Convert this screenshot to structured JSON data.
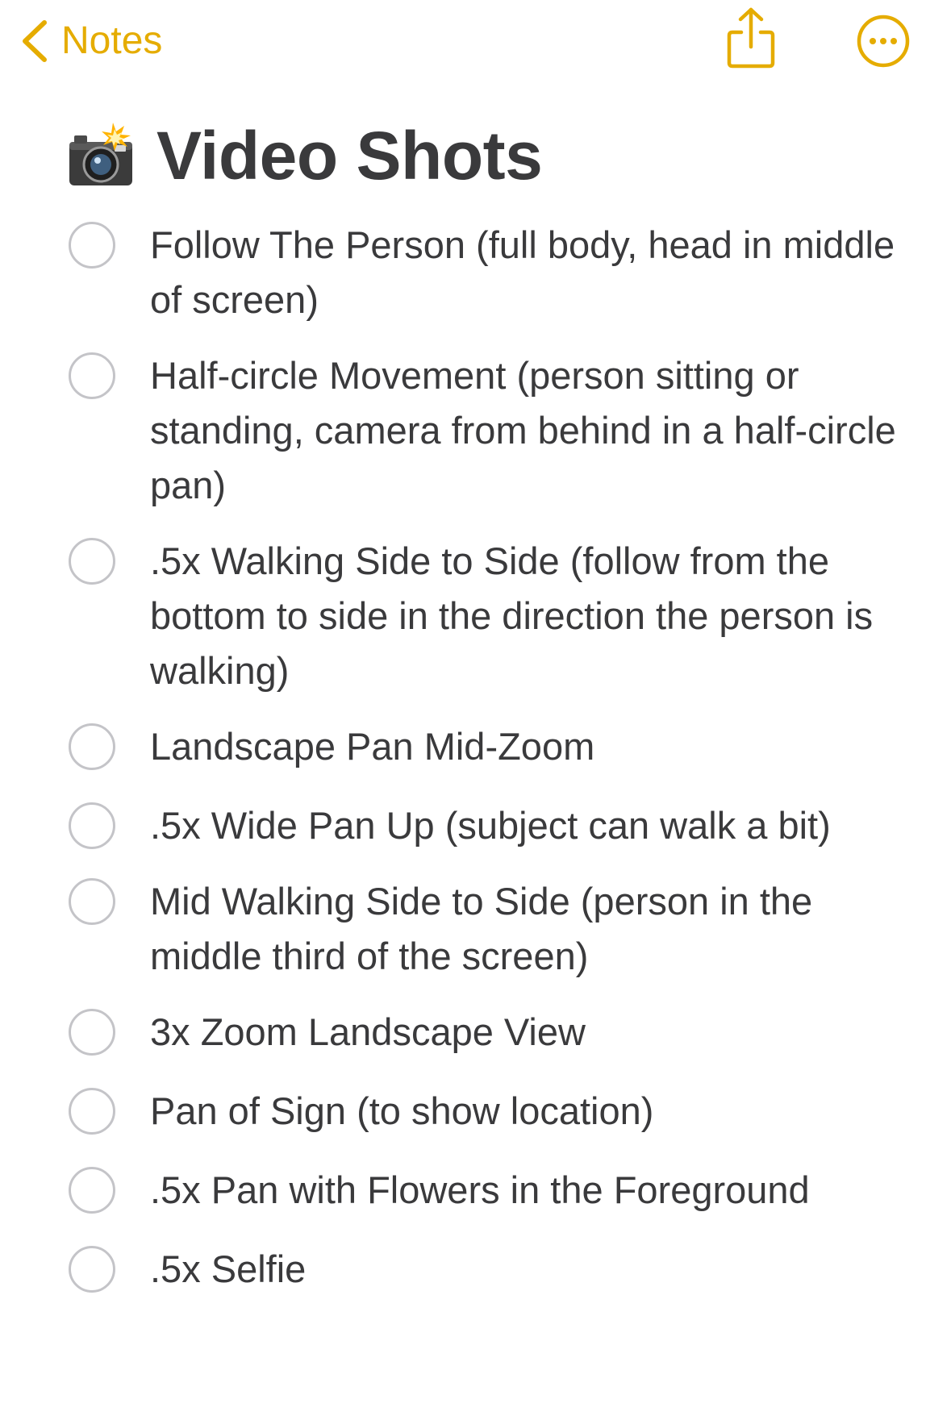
{
  "nav": {
    "back_label": "Notes",
    "back_icon": "chevron-left-icon",
    "share_icon": "share-icon",
    "more_icon": "ellipsis-circle-icon",
    "accent_color": "#e5ac00"
  },
  "note": {
    "title_emoji": "camera-with-flash-emoji",
    "title": "Video Shots",
    "checklist": [
      {
        "text": "Follow The Person (full body, head in middle of screen)",
        "checked": false
      },
      {
        "text": "Half-circle Movement (person sitting or standing, camera from behind in a half-circle pan)",
        "checked": false
      },
      {
        "text": ".5x Walking Side to Side (follow from the bottom to side in the direction the person is walking)",
        "checked": false
      },
      {
        "text": "Landscape Pan Mid-Zoom",
        "checked": false
      },
      {
        "text": ".5x Wide Pan Up (subject can walk a bit)",
        "checked": false
      },
      {
        "text": "Mid Walking Side to Side (person in the middle third of the screen)",
        "checked": false
      },
      {
        "text": "3x Zoom Landscape View",
        "checked": false
      },
      {
        "text": "Pan of Sign (to show location)",
        "checked": false
      },
      {
        "text": ".5x Pan with Flowers in the Foreground",
        "checked": false
      },
      {
        "text": ".5x Selfie",
        "checked": false
      }
    ]
  },
  "colors": {
    "text": "#3a3a3c",
    "circle_border": "#c4c4c8",
    "background": "#ffffff"
  }
}
